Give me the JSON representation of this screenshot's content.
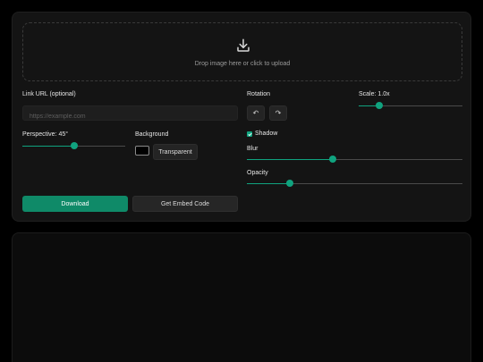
{
  "upload": {
    "text": "Drop image here or click to upload",
    "icon": "download-icon"
  },
  "link": {
    "label": "Link URL (optional)",
    "placeholder": "https://example.com",
    "value": ""
  },
  "rotation": {
    "label": "Rotation",
    "left_icon": "↶",
    "right_icon": "↷"
  },
  "scale": {
    "label": "Scale: 1.0x",
    "level": 0.2
  },
  "perspective": {
    "label": "Perspective: 45°",
    "level": 0.5
  },
  "background": {
    "label": "Background",
    "swatch_color": "#000000",
    "button_label": "Transparent"
  },
  "shadow": {
    "label": "Shadow",
    "checked": true
  },
  "blur": {
    "label": "Blur",
    "level": 0.4
  },
  "opacity": {
    "label": "Opacity",
    "level": 0.2
  },
  "actions": {
    "download": "Download",
    "embed": "Get Embed Code"
  },
  "colors": {
    "accent": "#10a37f",
    "panel": "#141414",
    "background": "#000000"
  }
}
